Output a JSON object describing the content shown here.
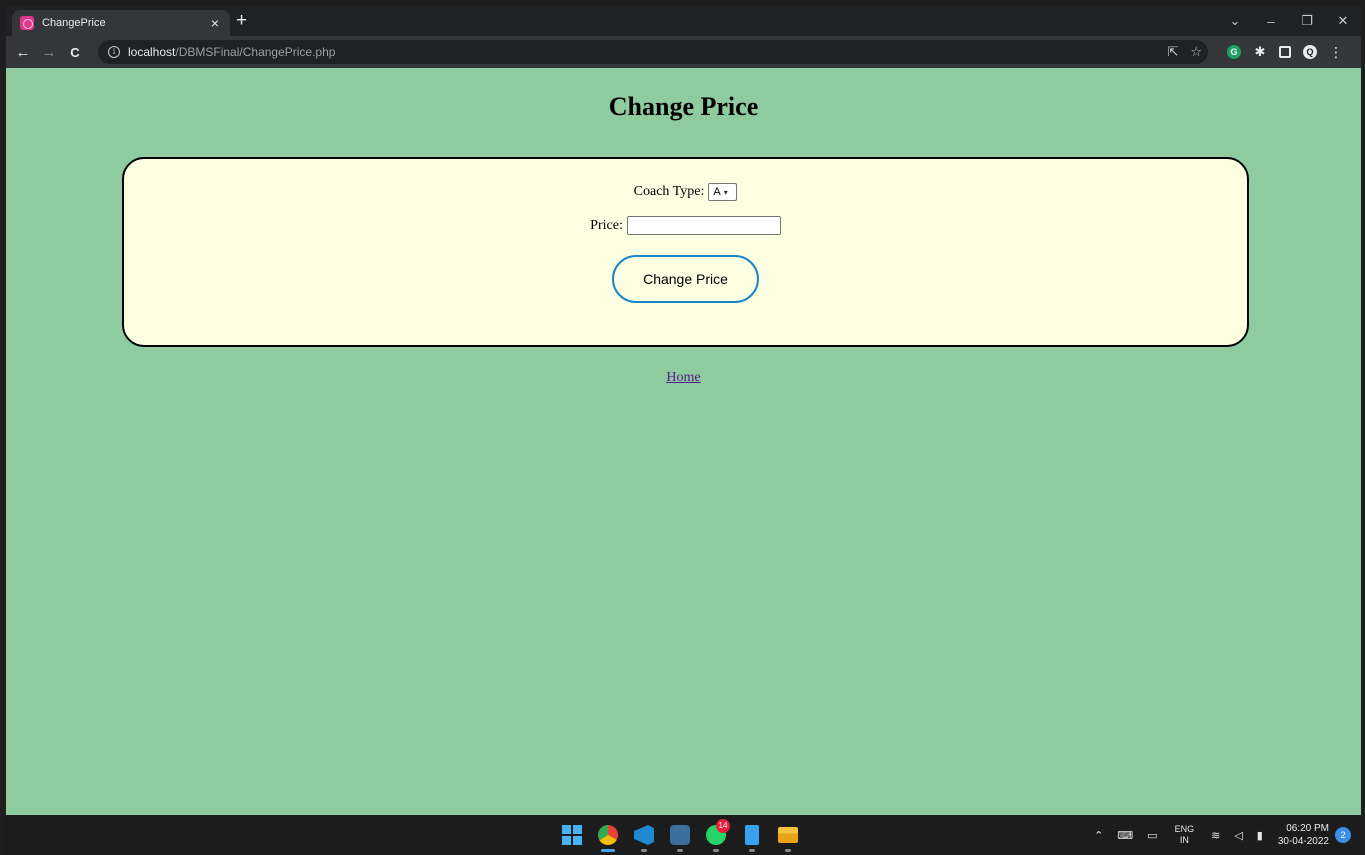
{
  "browser": {
    "tab_title": "ChangePrice",
    "tab_close": "×",
    "new_tab": "+",
    "url_host": "localhost",
    "url_path": "/DBMSFinal/ChangePrice.php",
    "window_controls": {
      "dropdown": "⌄",
      "minimize": "–",
      "restore": "❐",
      "close": "✕"
    },
    "nav": {
      "back": "←",
      "forward": "→",
      "reload": "C"
    },
    "extensions": {
      "grammarly": "G",
      "profile": "Q",
      "menu": "⋮"
    }
  },
  "page": {
    "title": "Change Price",
    "form": {
      "coach_type_label": "Coach Type:",
      "coach_type_selected": "A",
      "price_label": "Price:",
      "price_value": "",
      "submit_label": "Change Price"
    },
    "home_link": "Home"
  },
  "taskbar": {
    "whatsapp_badge": "14",
    "tray": {
      "lang_top": "ENG",
      "lang_bottom": "IN",
      "time": "06:20 PM",
      "date": "30-04-2022",
      "notifications": "2"
    }
  },
  "colors": {
    "page_bg": "#8ecb9f",
    "card_bg": "#fdffe2",
    "button_border": "#1a86c8",
    "link": "#551a8b",
    "tab_favicon": "#e0378a"
  }
}
